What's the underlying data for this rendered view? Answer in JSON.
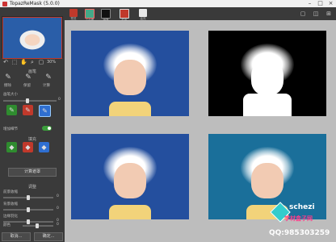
{
  "window": {
    "title": "TopazReMask (5.0.0)",
    "min": "–",
    "max": "□",
    "close": "×"
  },
  "left_panel": {
    "zoom": "30%",
    "section_brush": "画笔",
    "brush_labels": [
      "擦除",
      "保留",
      "计算"
    ],
    "brush_size_label": "画笔大小",
    "brush_size": "0",
    "edge_label": "边缘",
    "auto_label": "增加细节",
    "fill_label": "填充",
    "compute_button": "计算遮罩",
    "section_adjust": "调整",
    "sliders": [
      {
        "label": "前景收缩",
        "value": "0"
      },
      {
        "label": "背景收缩",
        "value": "0"
      },
      {
        "label": "边缘羽化",
        "value": "0"
      },
      {
        "label": "颜色",
        "value": "0"
      }
    ],
    "cancel_button": "取消...",
    "ok_button": "确定..."
  },
  "toolbar": {
    "modes": [
      "预览",
      "三分图",
      "遮罩",
      "红色",
      "高亮"
    ]
  },
  "watermark": {
    "brand": "schezi",
    "site": "学材盒子网",
    "qq": "QQ:985303259"
  }
}
